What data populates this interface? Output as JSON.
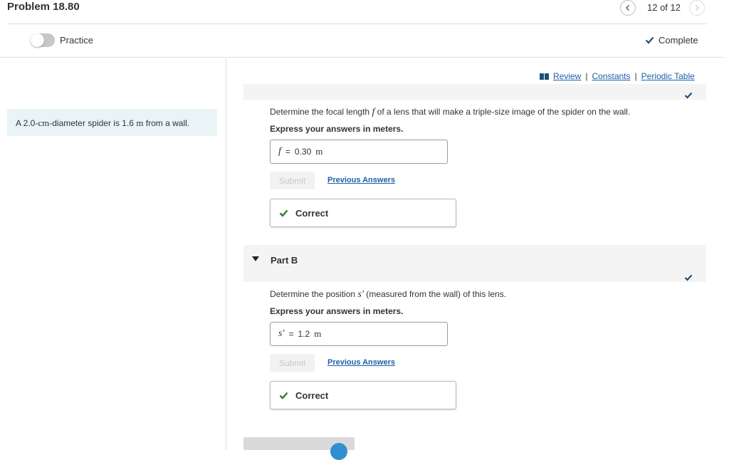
{
  "header": {
    "title": "Problem 18.80",
    "pager": "12 of 12"
  },
  "subheader": {
    "practice_label": "Practice",
    "complete_label": "Complete"
  },
  "problem": {
    "statement_prefix": "A 2.0-",
    "statement_cm": "cm",
    "statement_mid": "-diameter spider is 1.6",
    "statement_unit": "m",
    "statement_suffix": "from a wall."
  },
  "links": {
    "review": "Review",
    "constants": "Constants",
    "periodic_table": "Periodic Table",
    "separator": "|"
  },
  "part_a": {
    "question_prefix": "Determine the focal length",
    "question_var": "f",
    "question_suffix": "of a lens that will make a triple-size image of the spider on the wall.",
    "instruction": "Express your answers in meters.",
    "answer_var": "f",
    "answer_eq": "=",
    "answer_value": "0.30",
    "answer_unit": "m",
    "submit_label": "Submit",
    "previous_answers_label": "Previous Answers",
    "feedback": "Correct"
  },
  "part_b": {
    "label": "Part B",
    "question_prefix": "Determine the position",
    "question_var": "s′",
    "question_suffix": "(measured from the wall) of this lens.",
    "instruction": "Express your answers in meters.",
    "answer_var": "s′",
    "answer_eq": "=",
    "answer_value": "1.2",
    "answer_unit": "m",
    "submit_label": "Submit",
    "previous_answers_label": "Previous Answers",
    "feedback": "Correct"
  },
  "colors": {
    "link": "#1d5fa8",
    "check_green": "#2e7d32",
    "check_blue": "#1f4f7a",
    "problem_bg": "#eaf4f7"
  }
}
